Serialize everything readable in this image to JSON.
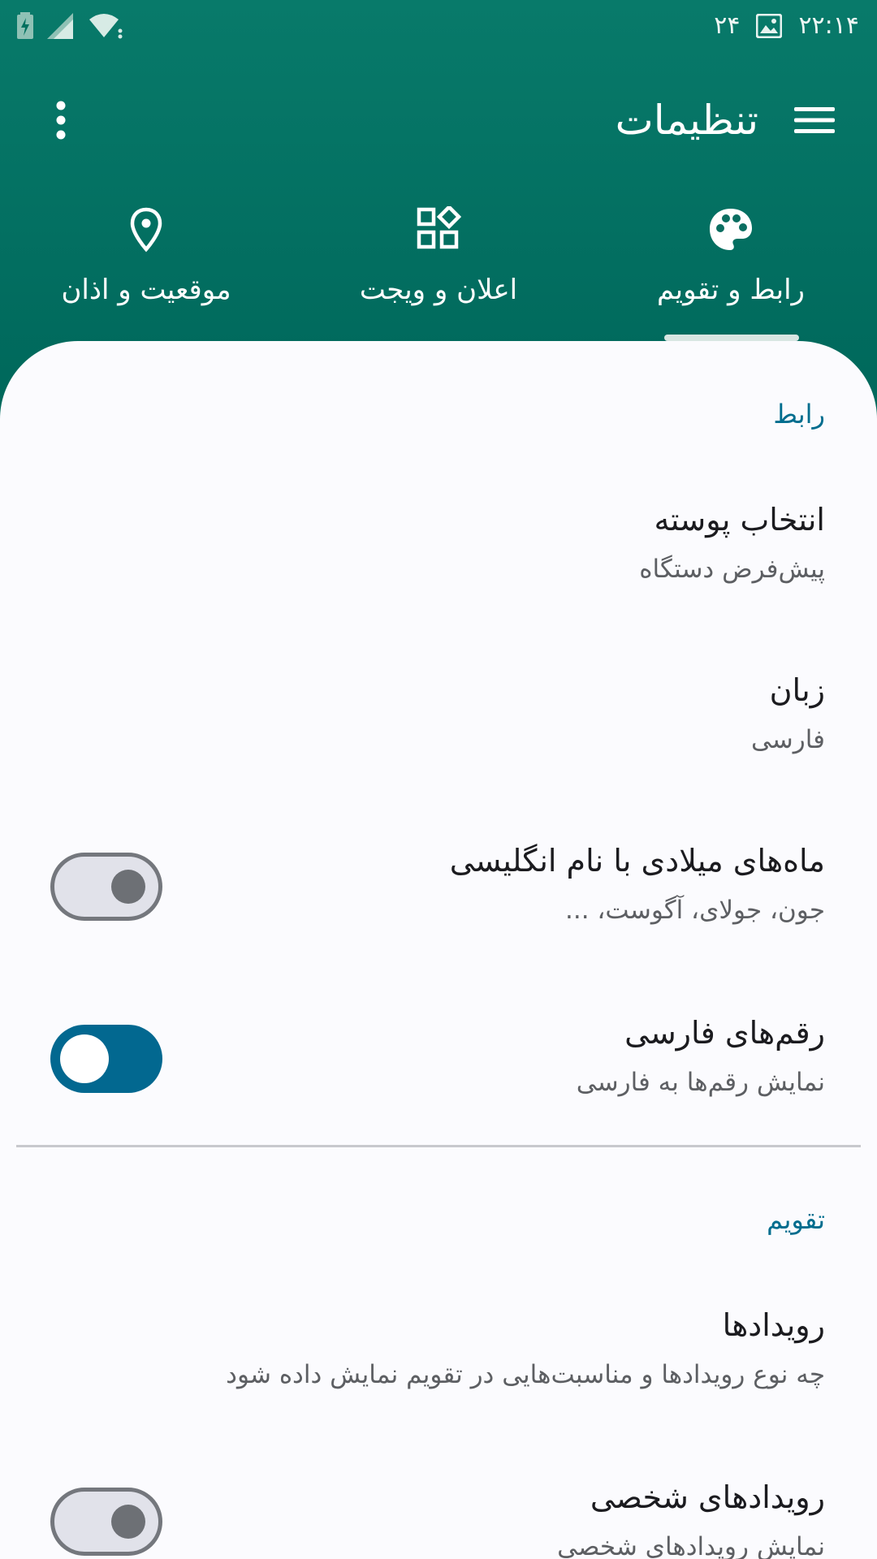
{
  "status_bar": {
    "time": "۲۲:۱۴",
    "notification_count": "۲۴",
    "icons": [
      "battery-charging-icon",
      "signal-icon",
      "wifi-icon",
      "image-notification-icon"
    ]
  },
  "toolbar": {
    "title": "تنظیمات",
    "menu_icon": "hamburger-menu-icon",
    "overflow_icon": "more-vertical-icon"
  },
  "tabs": [
    {
      "label": "رابط و تقویم",
      "icon": "palette-icon",
      "selected": true
    },
    {
      "label": "اعلان و ویجت",
      "icon": "widgets-icon",
      "selected": false
    },
    {
      "label": "موقعیت و اذان",
      "icon": "location-pin-icon",
      "selected": false
    }
  ],
  "sections": {
    "interface": {
      "header": "رابط",
      "items": [
        {
          "title": "انتخاب پوسته",
          "summary": "پیش‌فرض دستگاه"
        },
        {
          "title": "زبان",
          "summary": "فارسی"
        },
        {
          "title": "ماه‌های میلادی با نام انگلیسی",
          "summary": "جون، جولای، آگوست، ...",
          "switch_on": false
        },
        {
          "title": "رقم‌های فارسی",
          "summary": "نمایش رقم‌ها به فارسی",
          "switch_on": true
        }
      ]
    },
    "calendar": {
      "header": "تقویم",
      "items": [
        {
          "title": "رویدادها",
          "summary": "چه نوع رویدادها و مناسبت‌هایی در تقویم نمایش داده شود"
        },
        {
          "title": "رویدادهای شخصی",
          "summary": "نمایش رویدادهای شخصی",
          "switch_on": false
        }
      ]
    }
  },
  "colors": {
    "app_bar": "#00695c",
    "sheet_background": "#fbfbfe",
    "accent": "#006d8e",
    "switch_on": "#026890"
  }
}
